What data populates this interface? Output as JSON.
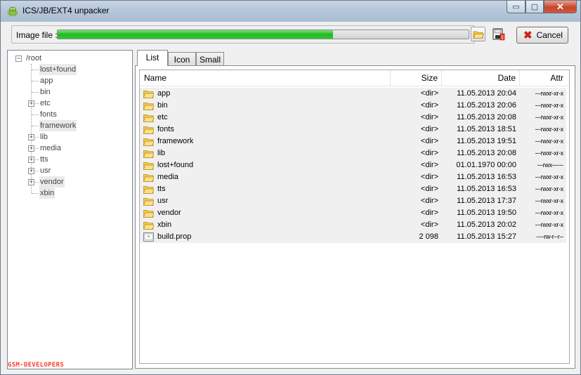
{
  "window": {
    "title": "ICS/JB/EXT4 unpacker",
    "min_glyph": "▭",
    "max_glyph": "▢",
    "close_glyph": "✕"
  },
  "toolbar": {
    "image_file_label": "Image file :",
    "progress_fraction": 0.67,
    "open_icon": "folder-open-icon",
    "save_icon": "save-image-icon",
    "cancel_label": "Cancel",
    "cancel_glyph": "✖"
  },
  "tree": {
    "root": {
      "label": "/root",
      "expander": "−"
    },
    "items": [
      {
        "label": "lost+found",
        "expandable": false,
        "expander": ""
      },
      {
        "label": "app",
        "expandable": false,
        "expander": ""
      },
      {
        "label": "bin",
        "expandable": false,
        "expander": ""
      },
      {
        "label": "etc",
        "expandable": true,
        "expander": "+"
      },
      {
        "label": "fonts",
        "expandable": false,
        "expander": ""
      },
      {
        "label": "framework",
        "expandable": false,
        "expander": ""
      },
      {
        "label": "lib",
        "expandable": true,
        "expander": "+"
      },
      {
        "label": "media",
        "expandable": true,
        "expander": "+"
      },
      {
        "label": "tts",
        "expandable": true,
        "expander": "+"
      },
      {
        "label": "usr",
        "expandable": true,
        "expander": "+"
      },
      {
        "label": "vendor",
        "expandable": true,
        "expander": "+"
      },
      {
        "label": "xbin",
        "expandable": false,
        "expander": ""
      }
    ]
  },
  "watermark": "GSM-DEVELOPERS",
  "tabs": [
    {
      "label": "List"
    },
    {
      "label": "Icon"
    },
    {
      "label": "Small"
    }
  ],
  "columns": {
    "name": "Name",
    "size": "Size",
    "date": "Date",
    "attr": "Attr"
  },
  "files": [
    {
      "name": "app",
      "size": "<dir>",
      "date": "11.05.2013 20:04",
      "attr": "---rwxr-xr-x",
      "type": "folder"
    },
    {
      "name": "bin",
      "size": "<dir>",
      "date": "11.05.2013 20:06",
      "attr": "---rwxr-xr-x",
      "type": "folder"
    },
    {
      "name": "etc",
      "size": "<dir>",
      "date": "11.05.2013 20:08",
      "attr": "---rwxr-xr-x",
      "type": "folder"
    },
    {
      "name": "fonts",
      "size": "<dir>",
      "date": "11.05.2013 18:51",
      "attr": "---rwxr-xr-x",
      "type": "folder"
    },
    {
      "name": "framework",
      "size": "<dir>",
      "date": "11.05.2013 19:51",
      "attr": "---rwxr-xr-x",
      "type": "folder"
    },
    {
      "name": "lib",
      "size": "<dir>",
      "date": "11.05.2013 20:08",
      "attr": "---rwxr-xr-x",
      "type": "folder"
    },
    {
      "name": "lost+found",
      "size": "<dir>",
      "date": "01.01.1970 00:00",
      "attr": "---rwx------",
      "type": "folder"
    },
    {
      "name": "media",
      "size": "<dir>",
      "date": "11.05.2013 16:53",
      "attr": "---rwxr-xr-x",
      "type": "folder"
    },
    {
      "name": "tts",
      "size": "<dir>",
      "date": "11.05.2013 16:53",
      "attr": "---rwxr-xr-x",
      "type": "folder"
    },
    {
      "name": "usr",
      "size": "<dir>",
      "date": "11.05.2013 17:37",
      "attr": "---rwxr-xr-x",
      "type": "folder"
    },
    {
      "name": "vendor",
      "size": "<dir>",
      "date": "11.05.2013 19:50",
      "attr": "---rwxr-xr-x",
      "type": "folder"
    },
    {
      "name": "xbin",
      "size": "<dir>",
      "date": "11.05.2013 20:02",
      "attr": "---rwxr-xr-x",
      "type": "folder"
    },
    {
      "name": "build.prop",
      "size": "2 098",
      "date": "11.05.2013 15:27",
      "attr": "----rw-r--r--",
      "type": "file"
    }
  ],
  "colors": {
    "progress": "#22bb22",
    "folder": "#f2c94c",
    "cancel_x": "#c8261a",
    "watermark": "#ff3a2a"
  }
}
